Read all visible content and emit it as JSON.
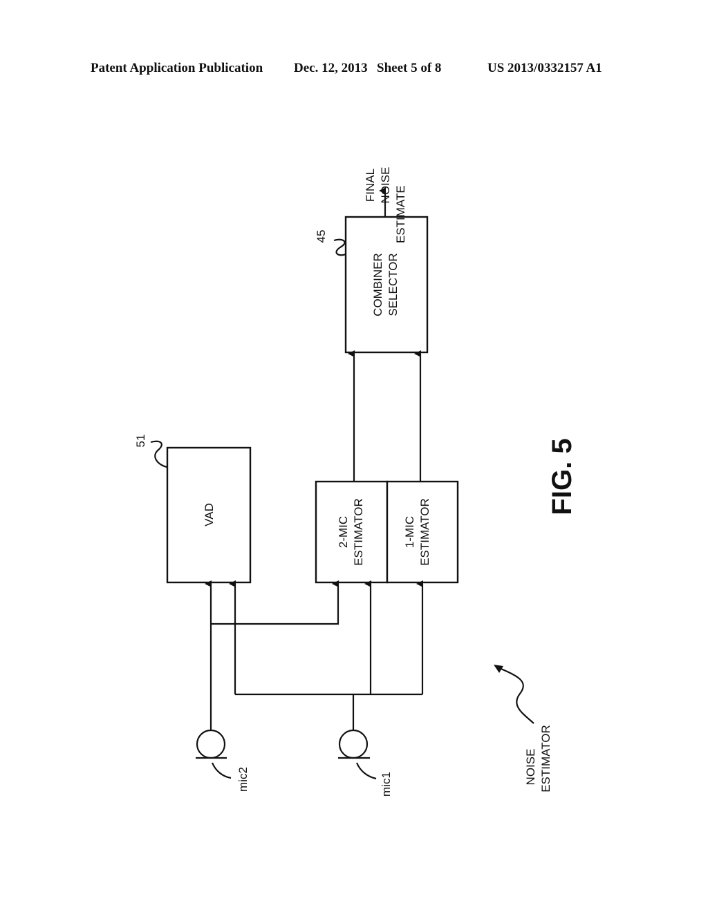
{
  "header": {
    "publication": "Patent Application Publication",
    "date": "Dec. 12, 2013",
    "sheet": "Sheet 5 of 8",
    "patent_number": "US 2013/0332157 A1"
  },
  "figure": {
    "label": "FIG. 5",
    "title_label": [
      "NOISE",
      "ESTIMATOR"
    ],
    "output_label": [
      "FINAL",
      "NOISE",
      "ESTIMATE"
    ],
    "blocks": {
      "combiner": {
        "ref": "45",
        "lines": [
          "COMBINER",
          "SELECTOR"
        ]
      },
      "vad": {
        "ref": "51",
        "lines": [
          "VAD"
        ]
      },
      "two_mic": {
        "lines": [
          "2-MIC",
          "ESTIMATOR"
        ]
      },
      "one_mic": {
        "lines": [
          "1-MIC",
          "ESTIMATOR"
        ]
      }
    },
    "mics": {
      "mic2": "mic2",
      "mic1": "mic1"
    }
  }
}
